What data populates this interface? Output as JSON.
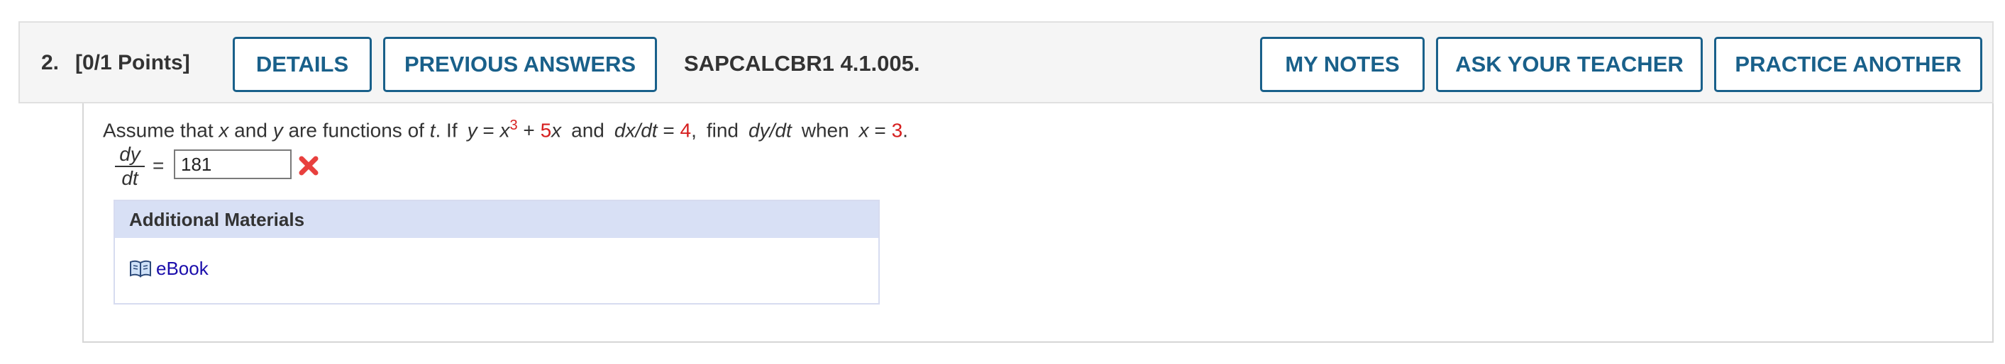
{
  "header": {
    "question_number": "2.",
    "points": "[0/1 Points]",
    "details_label": "DETAILS",
    "previous_answers_label": "PREVIOUS ANSWERS",
    "problem_code": "SAPCALCBR1 4.1.005.",
    "my_notes_label": "MY NOTES",
    "ask_teacher_label": "ASK YOUR TEACHER",
    "practice_another_label": "PRACTICE ANOTHER"
  },
  "question": {
    "t1": "Assume that ",
    "x": "x",
    "t2": " and ",
    "y": "y",
    "t3": " are functions of ",
    "t": "t",
    "t4": ". If",
    "eq_y": "y",
    "eq_equals": " = ",
    "eq_x": "x",
    "exp": "3",
    "plus": " + ",
    "coef": "5",
    "eq_x2": "x",
    "and": "and",
    "dxdt": "dx/dt",
    "equals2": " = ",
    "dxdt_val": "4",
    "comma": ",",
    "find": "find",
    "dydt": "dy/dt",
    "when": "when",
    "x_var": "x",
    "equals3": " = ",
    "x_val": "3",
    "period": "."
  },
  "answer": {
    "frac_num": "dy",
    "frac_den": "dt",
    "equals": "=",
    "value": "181",
    "status_icon": "incorrect-x-icon",
    "status_color": "#e8403e"
  },
  "materials": {
    "heading": "Additional Materials",
    "ebook_label": "eBook",
    "ebook_icon": "book-icon"
  },
  "colors": {
    "button_border": "#19608a",
    "highlight_red": "#d61f1f",
    "materials_header_bg": "#d8e0f5",
    "link": "#1a0dab"
  }
}
